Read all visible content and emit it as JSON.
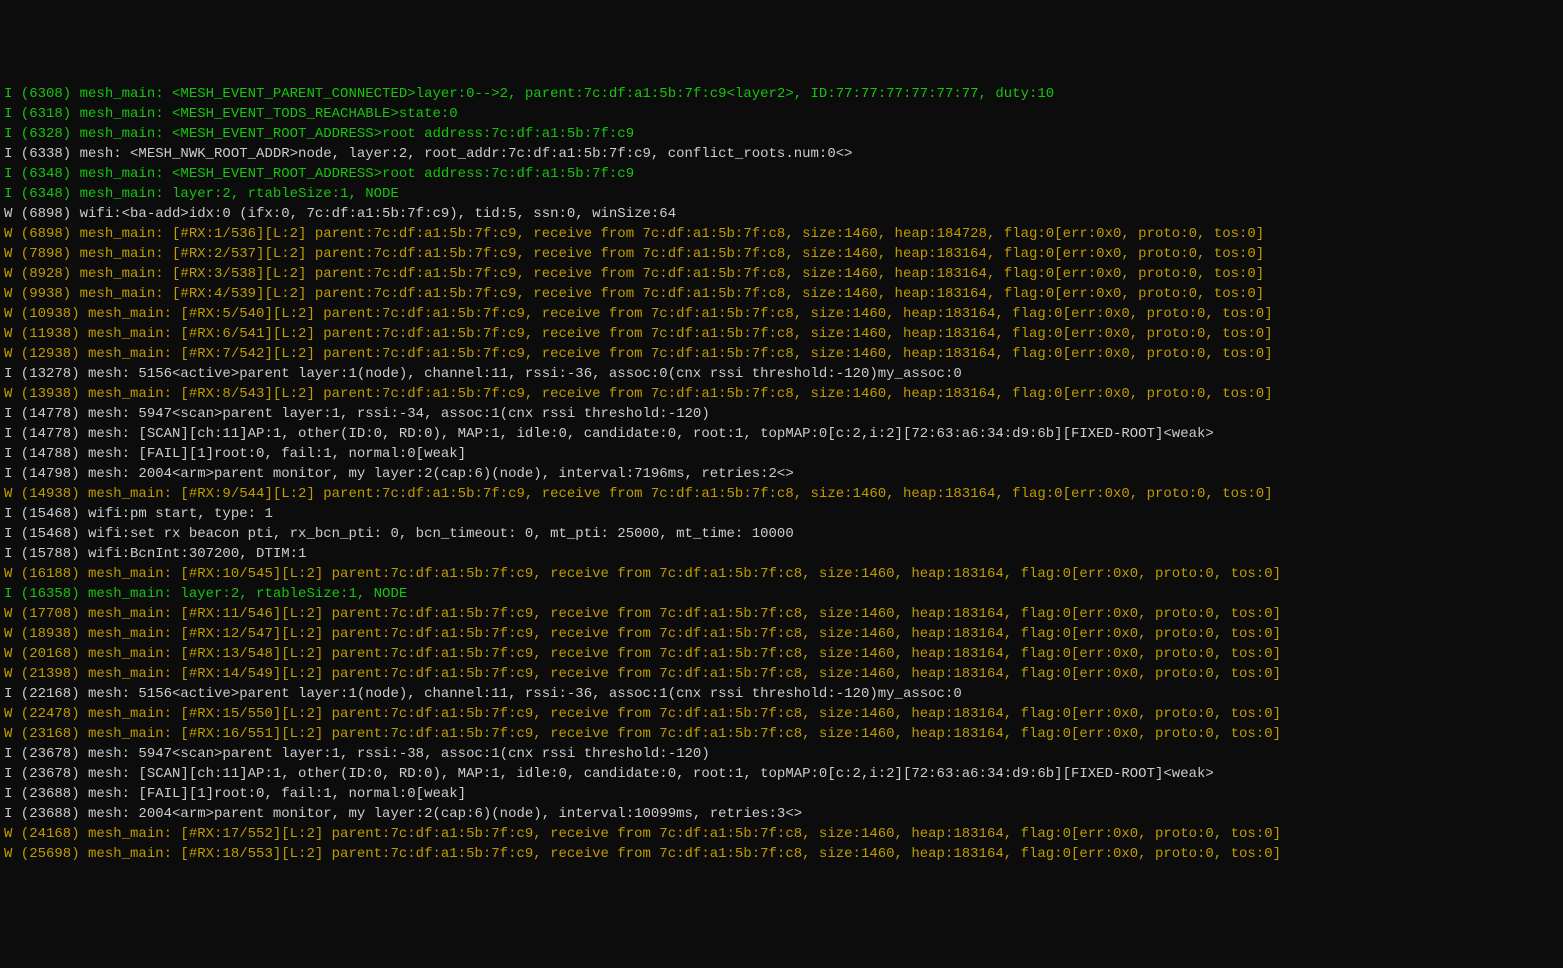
{
  "lines": [
    {
      "cls": "green",
      "text": "I (6308) mesh_main: <MESH_EVENT_PARENT_CONNECTED>layer:0-->2, parent:7c:df:a1:5b:7f:c9<layer2>, ID:77:77:77:77:77:77, duty:10"
    },
    {
      "cls": "green",
      "text": "I (6318) mesh_main: <MESH_EVENT_TODS_REACHABLE>state:0"
    },
    {
      "cls": "green",
      "text": "I (6328) mesh_main: <MESH_EVENT_ROOT_ADDRESS>root address:7c:df:a1:5b:7f:c9"
    },
    {
      "cls": "white",
      "text": "I (6338) mesh: <MESH_NWK_ROOT_ADDR>node, layer:2, root_addr:7c:df:a1:5b:7f:c9, conflict_roots.num:0<>"
    },
    {
      "cls": "green",
      "text": "I (6348) mesh_main: <MESH_EVENT_ROOT_ADDRESS>root address:7c:df:a1:5b:7f:c9"
    },
    {
      "cls": "green",
      "text": "I (6348) mesh_main: layer:2, rtableSize:1, NODE"
    },
    {
      "cls": "white",
      "text": "W (6898) wifi:<ba-add>idx:0 (ifx:0, 7c:df:a1:5b:7f:c9), tid:5, ssn:0, winSize:64"
    },
    {
      "cls": "yellow",
      "text": "W (6898) mesh_main: [#RX:1/536][L:2] parent:7c:df:a1:5b:7f:c9, receive from 7c:df:a1:5b:7f:c8, size:1460, heap:184728, flag:0[err:0x0, proto:0, tos:0]"
    },
    {
      "cls": "yellow",
      "text": "W (7898) mesh_main: [#RX:2/537][L:2] parent:7c:df:a1:5b:7f:c9, receive from 7c:df:a1:5b:7f:c8, size:1460, heap:183164, flag:0[err:0x0, proto:0, tos:0]"
    },
    {
      "cls": "yellow",
      "text": "W (8928) mesh_main: [#RX:3/538][L:2] parent:7c:df:a1:5b:7f:c9, receive from 7c:df:a1:5b:7f:c8, size:1460, heap:183164, flag:0[err:0x0, proto:0, tos:0]"
    },
    {
      "cls": "yellow",
      "text": "W (9938) mesh_main: [#RX:4/539][L:2] parent:7c:df:a1:5b:7f:c9, receive from 7c:df:a1:5b:7f:c8, size:1460, heap:183164, flag:0[err:0x0, proto:0, tos:0]"
    },
    {
      "cls": "yellow",
      "text": "W (10938) mesh_main: [#RX:5/540][L:2] parent:7c:df:a1:5b:7f:c9, receive from 7c:df:a1:5b:7f:c8, size:1460, heap:183164, flag:0[err:0x0, proto:0, tos:0]"
    },
    {
      "cls": "yellow",
      "text": "W (11938) mesh_main: [#RX:6/541][L:2] parent:7c:df:a1:5b:7f:c9, receive from 7c:df:a1:5b:7f:c8, size:1460, heap:183164, flag:0[err:0x0, proto:0, tos:0]"
    },
    {
      "cls": "yellow",
      "text": "W (12938) mesh_main: [#RX:7/542][L:2] parent:7c:df:a1:5b:7f:c9, receive from 7c:df:a1:5b:7f:c8, size:1460, heap:183164, flag:0[err:0x0, proto:0, tos:0]"
    },
    {
      "cls": "white",
      "text": "I (13278) mesh: 5156<active>parent layer:1(node), channel:11, rssi:-36, assoc:0(cnx rssi threshold:-120)my_assoc:0"
    },
    {
      "cls": "yellow",
      "text": "W (13938) mesh_main: [#RX:8/543][L:2] parent:7c:df:a1:5b:7f:c9, receive from 7c:df:a1:5b:7f:c8, size:1460, heap:183164, flag:0[err:0x0, proto:0, tos:0]"
    },
    {
      "cls": "white",
      "text": "I (14778) mesh: 5947<scan>parent layer:1, rssi:-34, assoc:1(cnx rssi threshold:-120)"
    },
    {
      "cls": "white",
      "text": "I (14778) mesh: [SCAN][ch:11]AP:1, other(ID:0, RD:0), MAP:1, idle:0, candidate:0, root:1, topMAP:0[c:2,i:2][72:63:a6:34:d9:6b][FIXED-ROOT]<weak>"
    },
    {
      "cls": "white",
      "text": "I (14788) mesh: [FAIL][1]root:0, fail:1, normal:0[weak]"
    },
    {
      "cls": "white",
      "text": ""
    },
    {
      "cls": "white",
      "text": "I (14798) mesh: 2004<arm>parent monitor, my layer:2(cap:6)(node), interval:7196ms, retries:2<>"
    },
    {
      "cls": "yellow",
      "text": "W (14938) mesh_main: [#RX:9/544][L:2] parent:7c:df:a1:5b:7f:c9, receive from 7c:df:a1:5b:7f:c8, size:1460, heap:183164, flag:0[err:0x0, proto:0, tos:0]"
    },
    {
      "cls": "white",
      "text": "I (15468) wifi:pm start, type: 1"
    },
    {
      "cls": "white",
      "text": ""
    },
    {
      "cls": "white",
      "text": "I (15468) wifi:set rx beacon pti, rx_bcn_pti: 0, bcn_timeout: 0, mt_pti: 25000, mt_time: 10000"
    },
    {
      "cls": "white",
      "text": "I (15788) wifi:BcnInt:307200, DTIM:1"
    },
    {
      "cls": "yellow",
      "text": "W (16188) mesh_main: [#RX:10/545][L:2] parent:7c:df:a1:5b:7f:c9, receive from 7c:df:a1:5b:7f:c8, size:1460, heap:183164, flag:0[err:0x0, proto:0, tos:0]"
    },
    {
      "cls": "green",
      "text": "I (16358) mesh_main: layer:2, rtableSize:1, NODE"
    },
    {
      "cls": "yellow",
      "text": "W (17708) mesh_main: [#RX:11/546][L:2] parent:7c:df:a1:5b:7f:c9, receive from 7c:df:a1:5b:7f:c8, size:1460, heap:183164, flag:0[err:0x0, proto:0, tos:0]"
    },
    {
      "cls": "yellow",
      "text": "W (18938) mesh_main: [#RX:12/547][L:2] parent:7c:df:a1:5b:7f:c9, receive from 7c:df:a1:5b:7f:c8, size:1460, heap:183164, flag:0[err:0x0, proto:0, tos:0]"
    },
    {
      "cls": "yellow",
      "text": "W (20168) mesh_main: [#RX:13/548][L:2] parent:7c:df:a1:5b:7f:c9, receive from 7c:df:a1:5b:7f:c8, size:1460, heap:183164, flag:0[err:0x0, proto:0, tos:0]"
    },
    {
      "cls": "yellow",
      "text": "W (21398) mesh_main: [#RX:14/549][L:2] parent:7c:df:a1:5b:7f:c9, receive from 7c:df:a1:5b:7f:c8, size:1460, heap:183164, flag:0[err:0x0, proto:0, tos:0]"
    },
    {
      "cls": "white",
      "text": "I (22168) mesh: 5156<active>parent layer:1(node), channel:11, rssi:-36, assoc:1(cnx rssi threshold:-120)my_assoc:0"
    },
    {
      "cls": "yellow",
      "text": "W (22478) mesh_main: [#RX:15/550][L:2] parent:7c:df:a1:5b:7f:c9, receive from 7c:df:a1:5b:7f:c8, size:1460, heap:183164, flag:0[err:0x0, proto:0, tos:0]"
    },
    {
      "cls": "yellow",
      "text": "W (23168) mesh_main: [#RX:16/551][L:2] parent:7c:df:a1:5b:7f:c9, receive from 7c:df:a1:5b:7f:c8, size:1460, heap:183164, flag:0[err:0x0, proto:0, tos:0]"
    },
    {
      "cls": "white",
      "text": "I (23678) mesh: 5947<scan>parent layer:1, rssi:-38, assoc:1(cnx rssi threshold:-120)"
    },
    {
      "cls": "white",
      "text": "I (23678) mesh: [SCAN][ch:11]AP:1, other(ID:0, RD:0), MAP:1, idle:0, candidate:0, root:1, topMAP:0[c:2,i:2][72:63:a6:34:d9:6b][FIXED-ROOT]<weak>"
    },
    {
      "cls": "white",
      "text": "I (23688) mesh: [FAIL][1]root:0, fail:1, normal:0[weak]"
    },
    {
      "cls": "white",
      "text": ""
    },
    {
      "cls": "white",
      "text": "I (23688) mesh: 2004<arm>parent monitor, my layer:2(cap:6)(node), interval:10099ms, retries:3<>"
    },
    {
      "cls": "yellow",
      "text": "W (24168) mesh_main: [#RX:17/552][L:2] parent:7c:df:a1:5b:7f:c9, receive from 7c:df:a1:5b:7f:c8, size:1460, heap:183164, flag:0[err:0x0, proto:0, tos:0]"
    },
    {
      "cls": "yellow",
      "text": "W (25698) mesh_main: [#RX:18/553][L:2] parent:7c:df:a1:5b:7f:c9, receive from 7c:df:a1:5b:7f:c8, size:1460, heap:183164, flag:0[err:0x0, proto:0, tos:0]"
    }
  ]
}
